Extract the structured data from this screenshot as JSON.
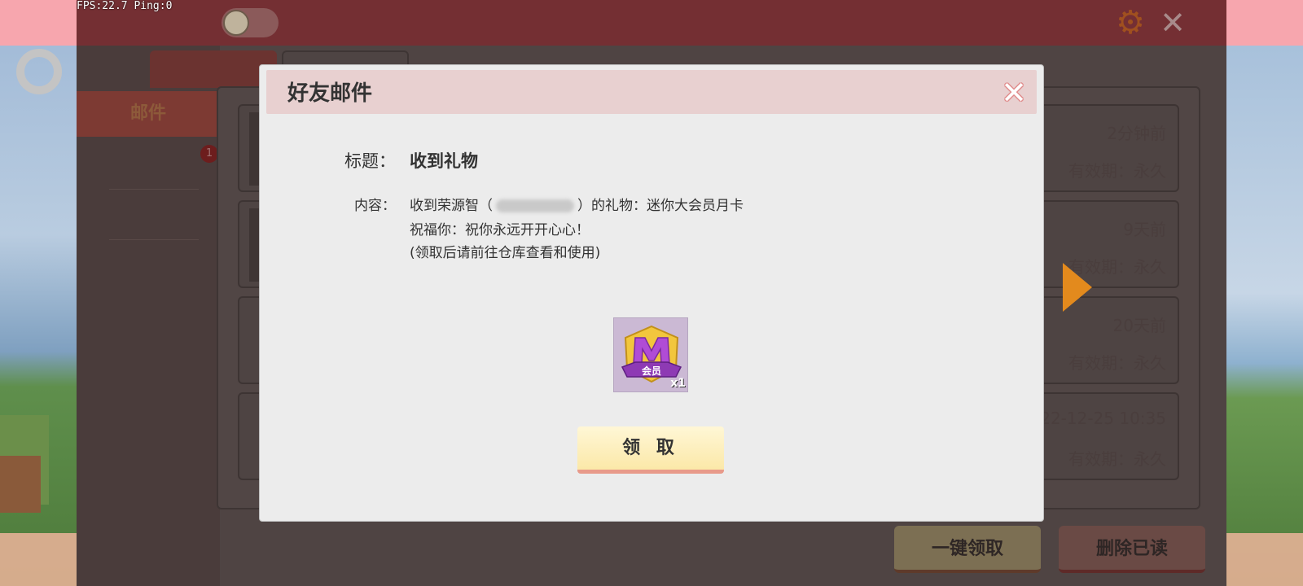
{
  "hud": {
    "fps_text": "FPS:22.7  Ping:0"
  },
  "mail_window": {
    "sidebar": {
      "tabs": [
        "邮件"
      ]
    },
    "mails": [
      {
        "time": "2分钟前",
        "expiry": "有效期：永久"
      },
      {
        "time": "9天前",
        "expiry": "有效期：永久"
      },
      {
        "time": "20天前",
        "expiry": "有效期：永久"
      },
      {
        "time": "2022-12-25 10:35",
        "expiry": "有效期：永久"
      }
    ],
    "buttons": {
      "claim_all": "一键领取",
      "delete_read": "删除已读"
    },
    "badge_count": "1"
  },
  "dialog": {
    "title": "好友邮件",
    "subject_label": "标题：",
    "subject_value": "收到礼物",
    "content_label": "内容：",
    "content_line1_prefix": "收到荣源智（",
    "content_line1_suffix": "）的礼物：迷你大会员月卡",
    "content_line2": "祝福你：祝你永远开开心心！",
    "content_line3": "(领取后请前往仓库查看和使用)",
    "reward": {
      "badge_text": "会员",
      "quantity": "x1"
    },
    "claim_button": "领 取"
  },
  "colors": {
    "dialog_bg": "#ececec",
    "dialog_header": "#e8d0d0",
    "claim_button": "#fbe8a8"
  }
}
